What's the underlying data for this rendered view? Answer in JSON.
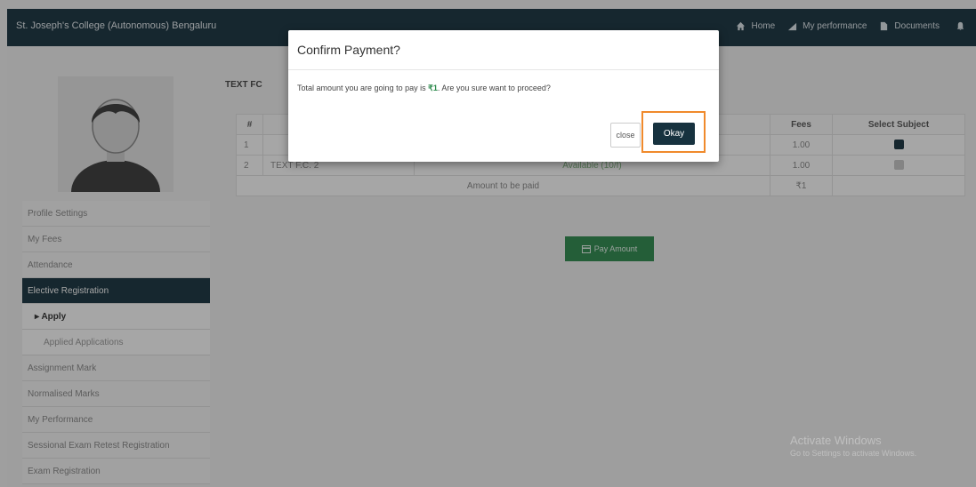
{
  "app": {
    "title": "St. Joseph's College (Autonomous) Bengaluru"
  },
  "nav": [
    {
      "label": "Home",
      "icon": "home-icon"
    },
    {
      "label": "My performance",
      "icon": "chart-icon"
    },
    {
      "label": "Documents",
      "icon": "document-icon"
    }
  ],
  "sidebar": {
    "items": [
      {
        "label": "Profile Settings"
      },
      {
        "label": "My Fees"
      },
      {
        "label": "Attendance"
      },
      {
        "label": "Elective Registration"
      },
      {
        "label": "Apply"
      },
      {
        "label": "Applied Applications"
      },
      {
        "label": "Assignment Mark"
      },
      {
        "label": "Normalised Marks"
      },
      {
        "label": "My Performance"
      },
      {
        "label": "Sessional Exam Retest Registration"
      },
      {
        "label": "Exam Registration"
      }
    ]
  },
  "main": {
    "title": "TEXT FC",
    "table": {
      "headers": [
        "#",
        "",
        "",
        "Fees",
        "Select Subject"
      ],
      "rows": [
        {
          "num": "1",
          "name": "",
          "status": "",
          "fees": "1.00",
          "selected": true
        },
        {
          "num": "2",
          "name": "TEXT F.C. 2",
          "status": "Available (10/f)",
          "fees": "1.00",
          "selected": false
        }
      ],
      "total_label": "Amount to be paid",
      "total_value": "₹1"
    },
    "pay_button": "Pay Amount"
  },
  "modal": {
    "title": "Confirm Payment?",
    "body_prefix": "Total amount you are going to pay is",
    "amount": "₹1",
    "body_suffix": ". Are you sure want to proceed?",
    "close_label": "close",
    "okay_label": "Okay"
  },
  "watermark": {
    "line1": "Activate Windows",
    "line2": "Go to Settings to activate Windows."
  },
  "colors": {
    "navbar": "#17323f",
    "accent_green": "#2e8b4e",
    "highlight": "#f08a2c"
  }
}
